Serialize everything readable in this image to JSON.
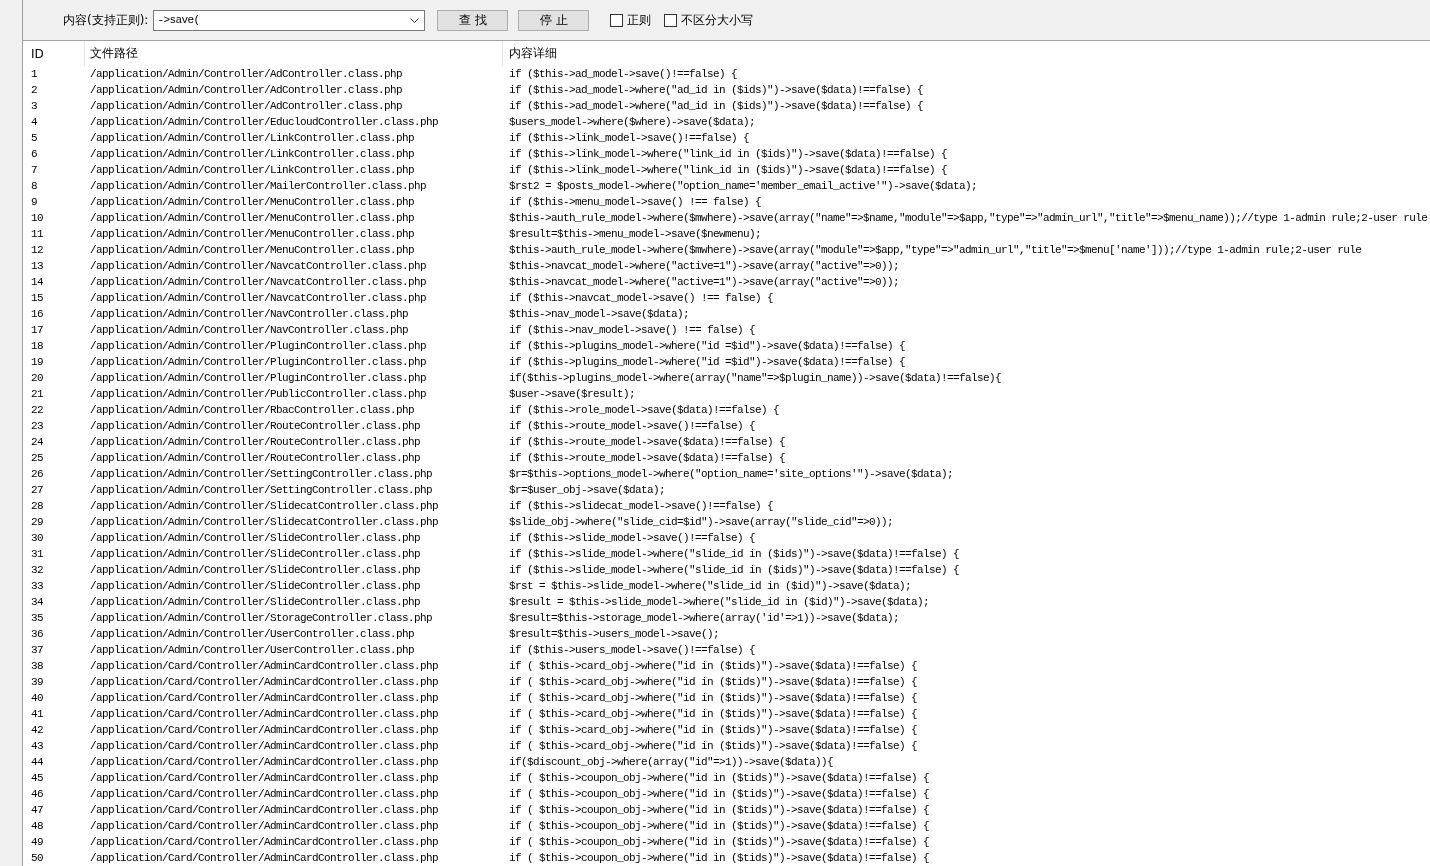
{
  "search_bar": {
    "label": "内容(支持正则):",
    "query": "->save(",
    "buttons": [
      "查 找",
      "停 止"
    ],
    "options": [
      {
        "label": "正则",
        "checked": false
      },
      {
        "label": "不区分大小写",
        "checked": false
      }
    ]
  },
  "results": {
    "columns": [
      "ID",
      "文件路径",
      "内容详细"
    ],
    "rows": [
      {
        "id": "1",
        "path": "/application/Admin/Controller/AdController.class.php",
        "content": "if ($this->ad_model->save()!==false) {"
      },
      {
        "id": "2",
        "path": "/application/Admin/Controller/AdController.class.php",
        "content": "if ($this->ad_model->where(\"ad_id in ($ids)\")->save($data)!==false) {"
      },
      {
        "id": "3",
        "path": "/application/Admin/Controller/AdController.class.php",
        "content": "if ($this->ad_model->where(\"ad_id in ($ids)\")->save($data)!==false) {"
      },
      {
        "id": "4",
        "path": "/application/Admin/Controller/EducloudController.class.php",
        "content": "$users_model->where($where)->save($data);"
      },
      {
        "id": "5",
        "path": "/application/Admin/Controller/LinkController.class.php",
        "content": "if ($this->link_model->save()!==false) {"
      },
      {
        "id": "6",
        "path": "/application/Admin/Controller/LinkController.class.php",
        "content": "if ($this->link_model->where(\"link_id in ($ids)\")->save($data)!==false) {"
      },
      {
        "id": "7",
        "path": "/application/Admin/Controller/LinkController.class.php",
        "content": "if ($this->link_model->where(\"link_id in ($ids)\")->save($data)!==false) {"
      },
      {
        "id": "8",
        "path": "/application/Admin/Controller/MailerController.class.php",
        "content": "$rst2 = $posts_model->where(\"option_name='member_email_active'\")->save($data);"
      },
      {
        "id": "9",
        "path": "/application/Admin/Controller/MenuController.class.php",
        "content": "if ($this->menu_model->save() !== false) {"
      },
      {
        "id": "10",
        "path": "/application/Admin/Controller/MenuController.class.php",
        "content": "$this->auth_rule_model->where($mwhere)->save(array(\"name\"=>$name,\"module\"=>$app,\"type\"=>\"admin_url\",\"title\"=>$menu_name));//type 1-admin rule;2-user rule"
      },
      {
        "id": "11",
        "path": "/application/Admin/Controller/MenuController.class.php",
        "content": "$result=$this->menu_model->save($newmenu);"
      },
      {
        "id": "12",
        "path": "/application/Admin/Controller/MenuController.class.php",
        "content": "$this->auth_rule_model->where($mwhere)->save(array(\"module\"=>$app,\"type\"=>\"admin_url\",\"title\"=>$menu['name']));//type 1-admin rule;2-user rule"
      },
      {
        "id": "13",
        "path": "/application/Admin/Controller/NavcatController.class.php",
        "content": "$this->navcat_model->where(\"active=1\")->save(array(\"active\"=>0));"
      },
      {
        "id": "14",
        "path": "/application/Admin/Controller/NavcatController.class.php",
        "content": "$this->navcat_model->where(\"active=1\")->save(array(\"active\"=>0));"
      },
      {
        "id": "15",
        "path": "/application/Admin/Controller/NavcatController.class.php",
        "content": "if ($this->navcat_model->save() !== false) {"
      },
      {
        "id": "16",
        "path": "/application/Admin/Controller/NavController.class.php",
        "content": "$this->nav_model->save($data);"
      },
      {
        "id": "17",
        "path": "/application/Admin/Controller/NavController.class.php",
        "content": "if ($this->nav_model->save() !== false) {"
      },
      {
        "id": "18",
        "path": "/application/Admin/Controller/PluginController.class.php",
        "content": "if ($this->plugins_model->where(\"id =$id\")->save($data)!==false) {"
      },
      {
        "id": "19",
        "path": "/application/Admin/Controller/PluginController.class.php",
        "content": "if ($this->plugins_model->where(\"id =$id\")->save($data)!==false) {"
      },
      {
        "id": "20",
        "path": "/application/Admin/Controller/PluginController.class.php",
        "content": "if($this->plugins_model->where(array(\"name\"=>$plugin_name))->save($data)!==false){"
      },
      {
        "id": "21",
        "path": "/application/Admin/Controller/PublicController.class.php",
        "content": "$user->save($result);"
      },
      {
        "id": "22",
        "path": "/application/Admin/Controller/RbacController.class.php",
        "content": "if ($this->role_model->save($data)!==false) {"
      },
      {
        "id": "23",
        "path": "/application/Admin/Controller/RouteController.class.php",
        "content": "if ($this->route_model->save()!==false) {"
      },
      {
        "id": "24",
        "path": "/application/Admin/Controller/RouteController.class.php",
        "content": "if ($this->route_model->save($data)!==false) {"
      },
      {
        "id": "25",
        "path": "/application/Admin/Controller/RouteController.class.php",
        "content": "if ($this->route_model->save($data)!==false) {"
      },
      {
        "id": "26",
        "path": "/application/Admin/Controller/SettingController.class.php",
        "content": "$r=$this->options_model->where(\"option_name='site_options'\")->save($data);"
      },
      {
        "id": "27",
        "path": "/application/Admin/Controller/SettingController.class.php",
        "content": "$r=$user_obj->save($data);"
      },
      {
        "id": "28",
        "path": "/application/Admin/Controller/SlidecatController.class.php",
        "content": "if ($this->slidecat_model->save()!==false) {"
      },
      {
        "id": "29",
        "path": "/application/Admin/Controller/SlidecatController.class.php",
        "content": "$slide_obj->where(\"slide_cid=$id\")->save(array(\"slide_cid\"=>0));"
      },
      {
        "id": "30",
        "path": "/application/Admin/Controller/SlideController.class.php",
        "content": "if ($this->slide_model->save()!==false) {"
      },
      {
        "id": "31",
        "path": "/application/Admin/Controller/SlideController.class.php",
        "content": "if ($this->slide_model->where(\"slide_id in ($ids)\")->save($data)!==false) {"
      },
      {
        "id": "32",
        "path": "/application/Admin/Controller/SlideController.class.php",
        "content": "if ($this->slide_model->where(\"slide_id in ($ids)\")->save($data)!==false) {"
      },
      {
        "id": "33",
        "path": "/application/Admin/Controller/SlideController.class.php",
        "content": "$rst = $this->slide_model->where(\"slide_id in ($id)\")->save($data);"
      },
      {
        "id": "34",
        "path": "/application/Admin/Controller/SlideController.class.php",
        "content": "$result = $this->slide_model->where(\"slide_id in ($id)\")->save($data);"
      },
      {
        "id": "35",
        "path": "/application/Admin/Controller/StorageController.class.php",
        "content": "$result=$this->storage_model->where(array('id'=>1))->save($data);"
      },
      {
        "id": "36",
        "path": "/application/Admin/Controller/UserController.class.php",
        "content": "$result=$this->users_model->save();"
      },
      {
        "id": "37",
        "path": "/application/Admin/Controller/UserController.class.php",
        "content": "if ($this->users_model->save()!==false) {"
      },
      {
        "id": "38",
        "path": "/application/Card/Controller/AdminCardController.class.php",
        "content": "if ( $this->card_obj->where(\"id in ($tids)\")->save($data)!==false) {"
      },
      {
        "id": "39",
        "path": "/application/Card/Controller/AdminCardController.class.php",
        "content": "if ( $this->card_obj->where(\"id in ($tids)\")->save($data)!==false) {"
      },
      {
        "id": "40",
        "path": "/application/Card/Controller/AdminCardController.class.php",
        "content": "if ( $this->card_obj->where(\"id in ($tids)\")->save($data)!==false) {"
      },
      {
        "id": "41",
        "path": "/application/Card/Controller/AdminCardController.class.php",
        "content": "if ( $this->card_obj->where(\"id in ($tids)\")->save($data)!==false) {"
      },
      {
        "id": "42",
        "path": "/application/Card/Controller/AdminCardController.class.php",
        "content": "if ( $this->card_obj->where(\"id in ($tids)\")->save($data)!==false) {"
      },
      {
        "id": "43",
        "path": "/application/Card/Controller/AdminCardController.class.php",
        "content": "if ( $this->card_obj->where(\"id in ($tids)\")->save($data)!==false) {"
      },
      {
        "id": "44",
        "path": "/application/Card/Controller/AdminCardController.class.php",
        "content": "if($discount_obj->where(array(\"id\"=>1))->save($data)){"
      },
      {
        "id": "45",
        "path": "/application/Card/Controller/AdminCardController.class.php",
        "content": "if ( $this->coupon_obj->where(\"id in ($tids)\")->save($data)!==false) {"
      },
      {
        "id": "46",
        "path": "/application/Card/Controller/AdminCardController.class.php",
        "content": "if ( $this->coupon_obj->where(\"id in ($tids)\")->save($data)!==false) {"
      },
      {
        "id": "47",
        "path": "/application/Card/Controller/AdminCardController.class.php",
        "content": "if ( $this->coupon_obj->where(\"id in ($tids)\")->save($data)!==false) {"
      },
      {
        "id": "48",
        "path": "/application/Card/Controller/AdminCardController.class.php",
        "content": "if ( $this->coupon_obj->where(\"id in ($tids)\")->save($data)!==false) {"
      },
      {
        "id": "49",
        "path": "/application/Card/Controller/AdminCardController.class.php",
        "content": "if ( $this->coupon_obj->where(\"id in ($tids)\")->save($data)!==false) {"
      },
      {
        "id": "50",
        "path": "/application/Card/Controller/AdminCardController.class.php",
        "content": "if ( $this->coupon_obj->where(\"id in ($tids)\")->save($data)!==false) {"
      }
    ]
  }
}
